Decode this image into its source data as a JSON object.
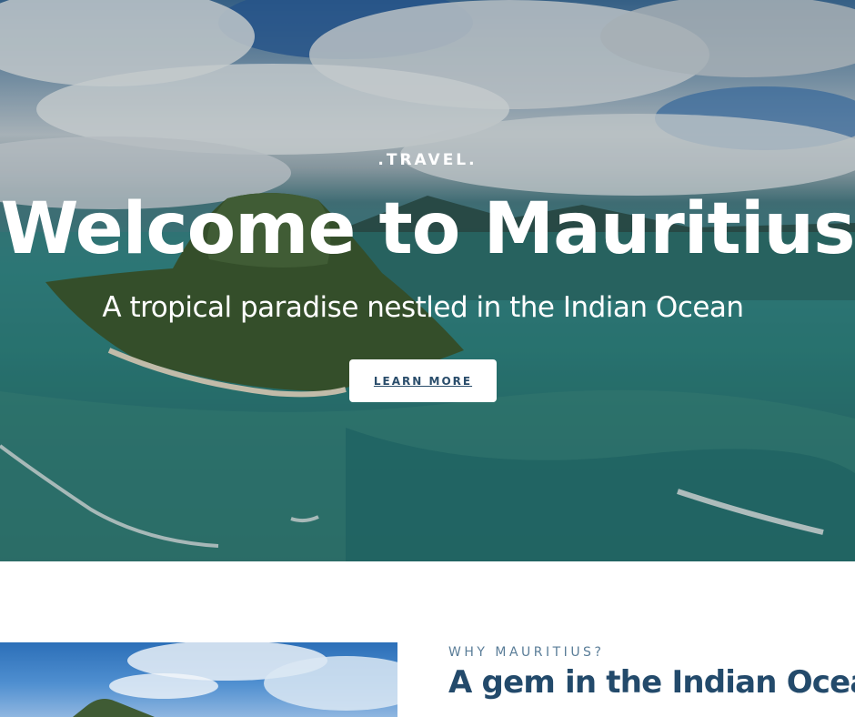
{
  "hero": {
    "eyebrow": ".TRAVEL.",
    "title": "Welcome to Mauritius",
    "subtitle": "A tropical paradise nestled in the Indian Ocean",
    "cta_label": "LEARN MORE"
  },
  "intro": {
    "eyebrow": "WHY MAURITIUS?",
    "title": "A gem in the Indian Ocean"
  }
}
